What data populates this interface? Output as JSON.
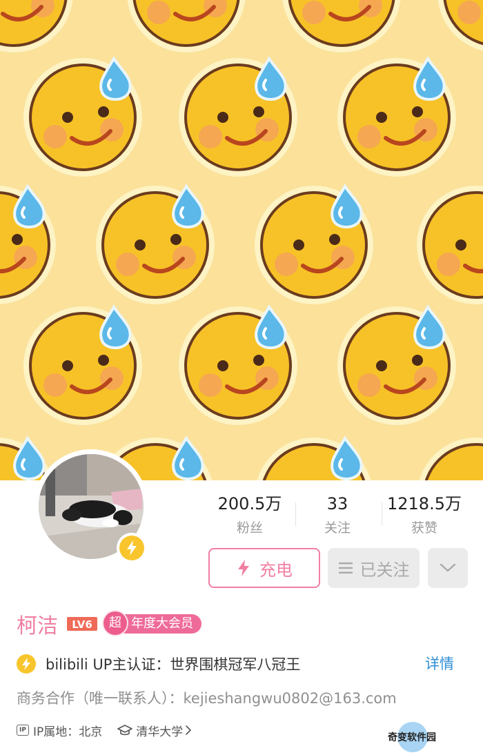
{
  "profile": {
    "name": "柯洁",
    "level": "LV6",
    "vip_badge": "超",
    "vip_label": "年度大会员"
  },
  "stats": [
    {
      "value": "200.5万",
      "label": "粉丝"
    },
    {
      "value": "33",
      "label": "关注"
    },
    {
      "value": "1218.5万",
      "label": "获赞"
    }
  ],
  "actions": {
    "charge_label": "充电",
    "follow_label": "已关注"
  },
  "certification": {
    "text": "bilibili UP主认证：世界围棋冠军八冠王",
    "detail_label": "详情"
  },
  "business": "商务合作（唯一联系人）：kejieshangwu0802@163.com",
  "meta": {
    "ip_icon_text": "IP",
    "ip_location": "IP属地：北京",
    "school": "清华大学"
  },
  "watermark": "奇变软件园",
  "colors": {
    "accent_pink": "#f07fa2",
    "link_blue": "#2f8ed5",
    "badge_yellow": "#f8c52c",
    "banner_bg": "#fbe19a"
  },
  "icons": [
    "lightning-icon",
    "list-icon",
    "chevron-down-icon",
    "ip-icon",
    "graduation-cap-icon",
    "chevron-right-icon",
    "sweat-smile-emoji"
  ]
}
